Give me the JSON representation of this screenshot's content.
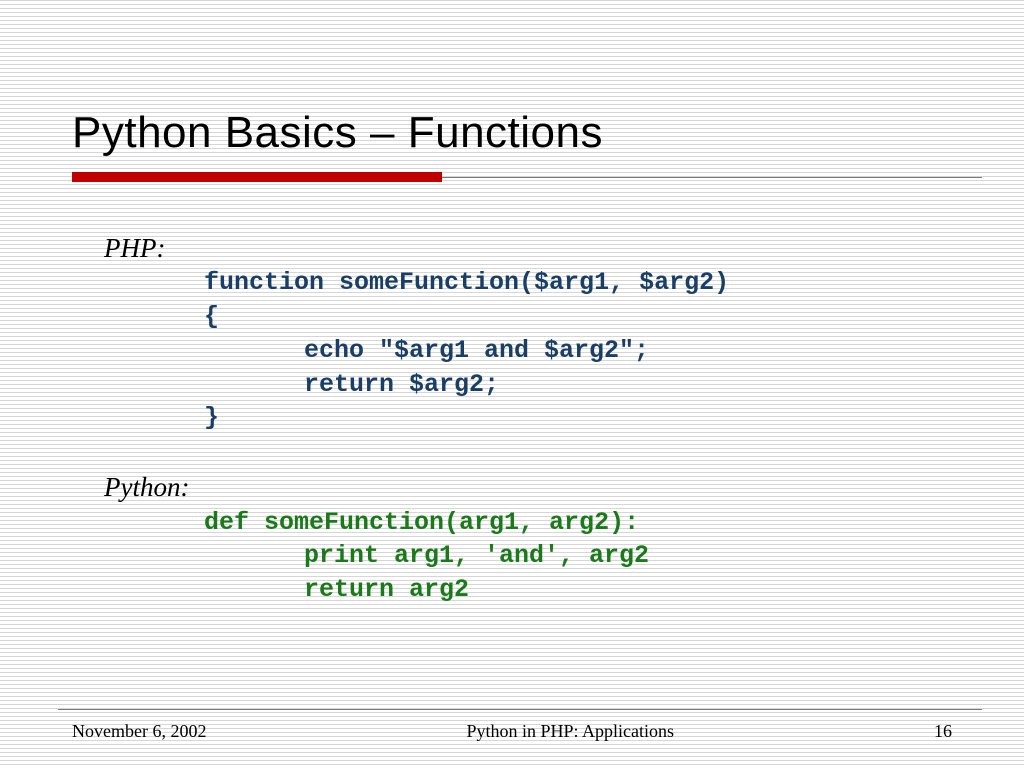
{
  "title": "Python Basics – Functions",
  "php": {
    "label": "PHP:",
    "line1": "function someFunction($arg1, $arg2)",
    "line2": "{",
    "line3": "echo \"$arg1 and $arg2\";",
    "line4": "return $arg2;",
    "line5": "}"
  },
  "python": {
    "label": "Python:",
    "line1": "def someFunction(arg1, arg2):",
    "line2": "print arg1, 'and', arg2",
    "line3": "return arg2"
  },
  "footer": {
    "date": "November 6, 2002",
    "center": "Python in PHP: Applications",
    "page": "16"
  }
}
